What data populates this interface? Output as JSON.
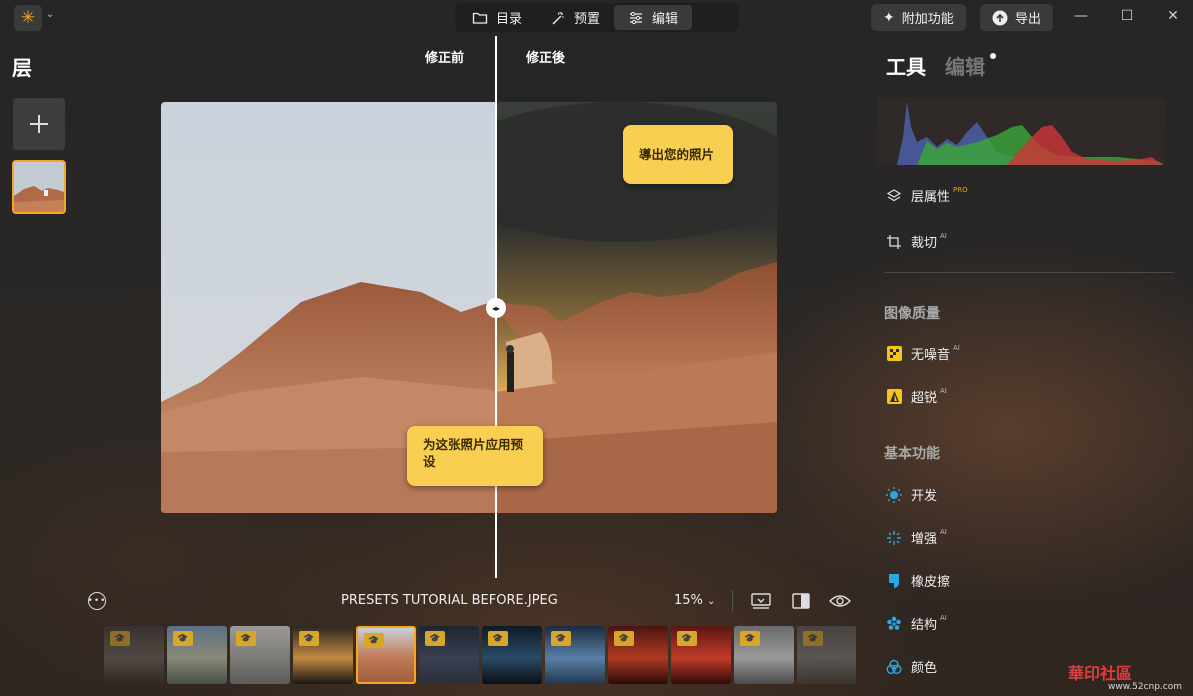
{
  "topbar": {
    "tabs": [
      {
        "label": "目录",
        "icon": "folder-icon"
      },
      {
        "label": "预置",
        "icon": "magic-wand-icon"
      },
      {
        "label": "编辑",
        "icon": "sliders-icon"
      }
    ],
    "active_tab": "编辑",
    "addons_label": "附加功能",
    "export_label": "导出"
  },
  "layers": {
    "title": "层"
  },
  "canvas": {
    "before_label": "修正前",
    "after_label": "修正後",
    "tip_export": "導出您的照片",
    "tip_preset": "为这张照片应用预设"
  },
  "bottombar": {
    "filename": "PRESETS TUTORIAL BEFORE.JPEG",
    "zoom": "15%"
  },
  "filmstrip": {
    "items": [
      {
        "name": "thumb-1",
        "colors": [
          "#3b3a39",
          "#6a6560",
          "#2e2b29"
        ]
      },
      {
        "name": "thumb-2",
        "colors": [
          "#5b6f86",
          "#8a8a78",
          "#45504a"
        ]
      },
      {
        "name": "thumb-3",
        "colors": [
          "#9a9a98",
          "#7d7b78",
          "#5e5c5a"
        ]
      },
      {
        "name": "thumb-4",
        "colors": [
          "#2a2622",
          "#c08a40",
          "#1a1816"
        ]
      },
      {
        "name": "thumb-5",
        "colors": [
          "#c8cfd7",
          "#c07a55",
          "#a15f3f"
        ]
      },
      {
        "name": "thumb-6",
        "colors": [
          "#1e2430",
          "#3a4050",
          "#2a2f3a"
        ]
      },
      {
        "name": "thumb-7",
        "colors": [
          "#0f1a25",
          "#2a4a66",
          "#0a0f14"
        ]
      },
      {
        "name": "thumb-8",
        "colors": [
          "#1b2b40",
          "#5a7fa6",
          "#22384f"
        ]
      },
      {
        "name": "thumb-9",
        "colors": [
          "#4a1410",
          "#b03a22",
          "#2a0c08"
        ]
      },
      {
        "name": "thumb-10",
        "colors": [
          "#5a1612",
          "#c23a2a",
          "#2e0a08"
        ]
      },
      {
        "name": "thumb-11",
        "colors": [
          "#6a6a6a",
          "#9a9a9a",
          "#4a4a4a"
        ]
      },
      {
        "name": "thumb-12",
        "colors": [
          "#595959",
          "#7a7a7a",
          "#3e3e3e"
        ]
      }
    ],
    "active_index": 4
  },
  "rightpanel": {
    "tab_tools": "工具",
    "tab_edit": "编辑",
    "tools": [
      {
        "label": "层属性",
        "badge": "PRO",
        "icon": "layers-icon"
      },
      {
        "label": "裁切",
        "badge": "AI",
        "icon": "crop-icon"
      }
    ],
    "section_quality": "图像质量",
    "quality_tools": [
      {
        "label": "无噪音",
        "badge": "AI",
        "icon": "denoise-icon"
      },
      {
        "label": "超锐",
        "badge": "AI",
        "icon": "sharpen-icon"
      }
    ],
    "section_basic": "基本功能",
    "basic_tools": [
      {
        "label": "开发",
        "badge": "",
        "icon": "develop-sun-icon"
      },
      {
        "label": "增强",
        "badge": "AI",
        "icon": "enhance-sparkle-icon"
      },
      {
        "label": "橡皮擦",
        "badge": "",
        "icon": "eraser-icon"
      },
      {
        "label": "结构",
        "badge": "AI",
        "icon": "structure-icon"
      },
      {
        "label": "颜色",
        "badge": "",
        "icon": "color-icon"
      }
    ]
  },
  "watermark": {
    "text": "華印社區",
    "url": "www.52cnp.com"
  },
  "colors": {
    "accent": "#f5a623",
    "tooltip": "#f9cf52",
    "basic_icon": "#2aa8e0",
    "quality_icon": "#f5c518"
  }
}
